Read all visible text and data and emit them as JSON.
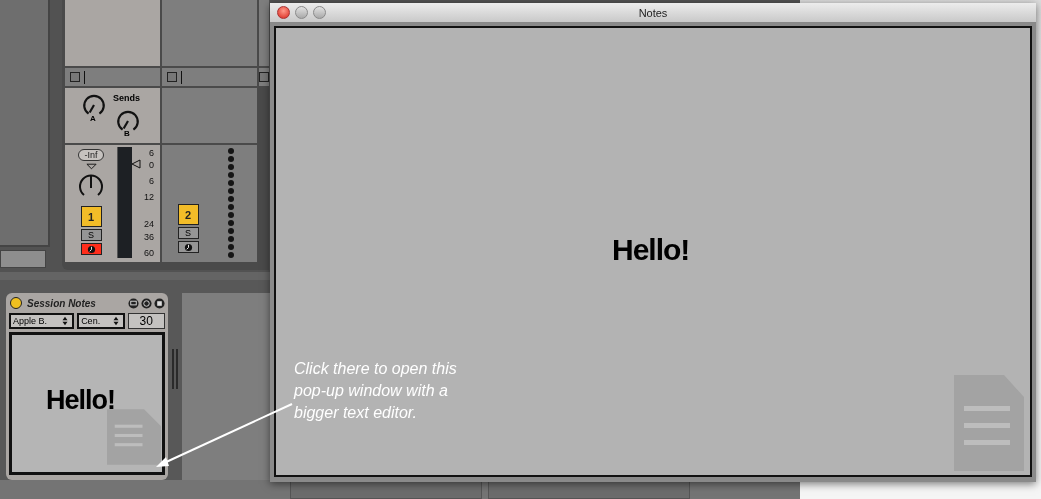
{
  "mixer": {
    "sends_label": "Sends",
    "send_labels": [
      "A",
      "B"
    ],
    "meter_scale": [
      "6",
      "0",
      "6",
      "12",
      "24",
      "36",
      "60"
    ],
    "tracks": [
      {
        "number": "1",
        "active": true,
        "solo": "S",
        "solo_on": false,
        "armed": true,
        "volume": "-Inf",
        "kind": "audio"
      },
      {
        "number": "2",
        "active": true,
        "solo": "S",
        "solo_on": false,
        "armed": false,
        "kind": "empty"
      }
    ]
  },
  "session_notes": {
    "title": "Session Notes",
    "font": "Apple B.",
    "align": "Cen.",
    "size": "30",
    "text": "Hello!"
  },
  "annotation": "Click there to open this pop-up window with a bigger text editor.",
  "notes_window": {
    "title": "Notes",
    "text": "Hello!"
  }
}
